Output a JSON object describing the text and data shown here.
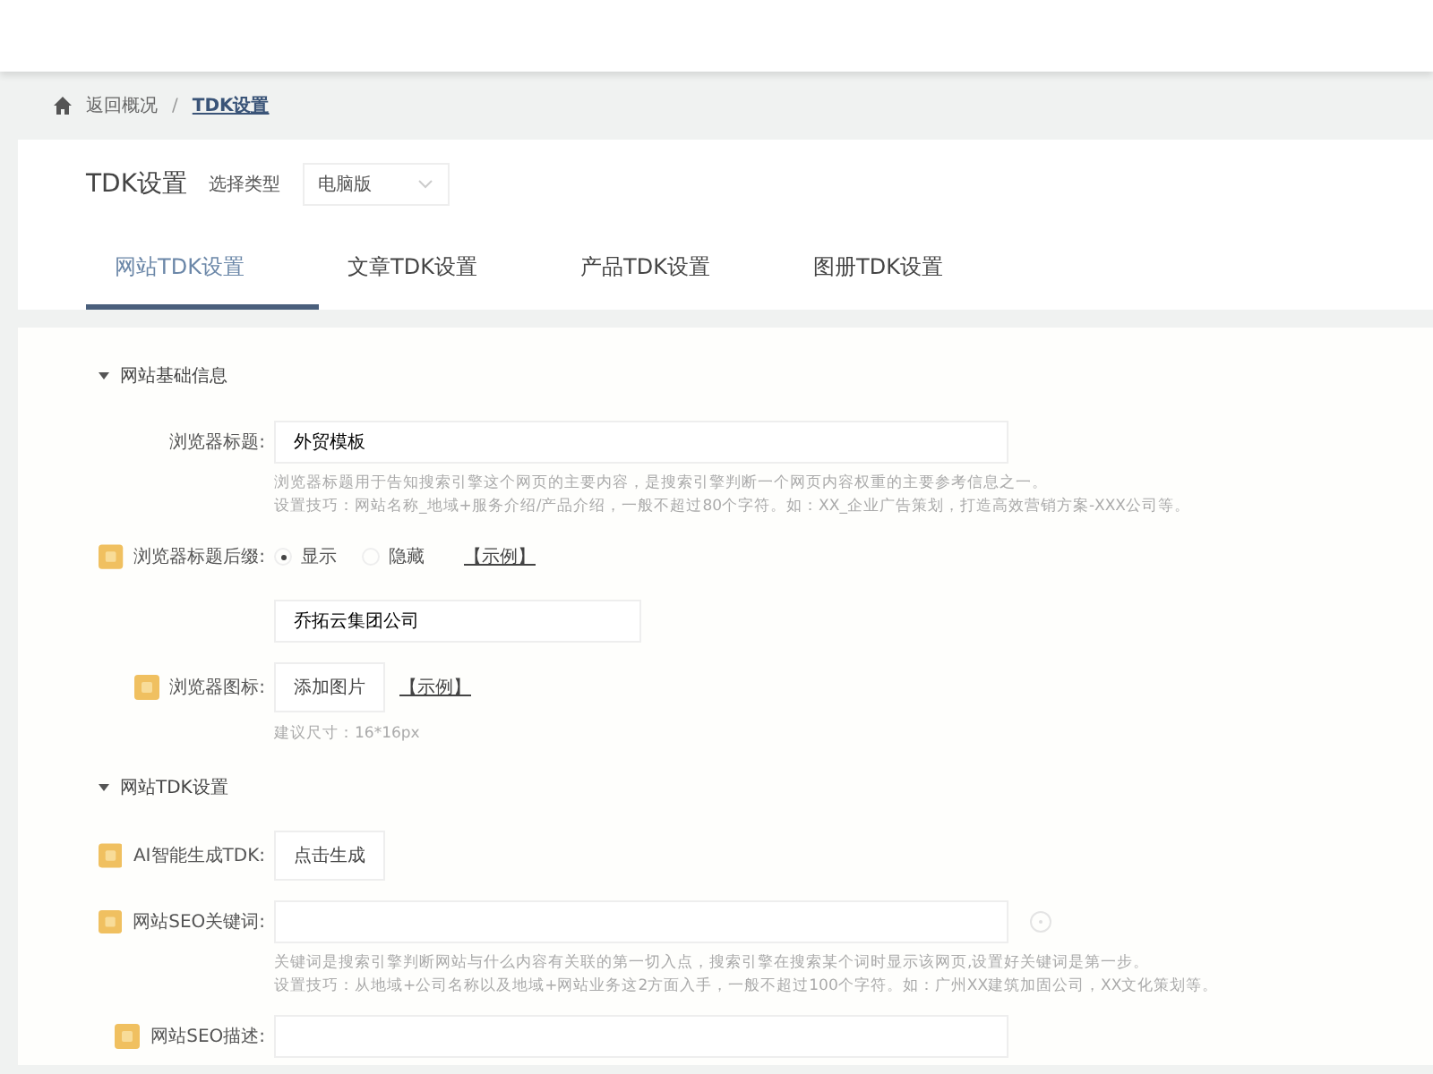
{
  "breadcrumb": [
    {
      "label": "返回概况"
    },
    {
      "label": "TDK设置"
    }
  ],
  "breadcrumb_separator": "/",
  "header": {
    "title": "TDK设置",
    "type_label": "选择类型",
    "type_value": "电脑版"
  },
  "tabs": [
    {
      "label": "网站TDK设置",
      "selected": true
    },
    {
      "label": "文章TDK设置",
      "selected": false
    },
    {
      "label": "产品TDK设置",
      "selected": false
    },
    {
      "label": "图册TDK设置",
      "selected": false
    }
  ],
  "sections": [
    {
      "title": "网站基础信息",
      "expanded": true,
      "fields": [
        {
          "kind": "text",
          "badge": false,
          "label": "浏览器标题:",
          "value": "外贸模板",
          "wide": true,
          "help": [
            "浏览器标题用于告知搜索引擎这个网页的主要内容，是搜索引擎判断一个网页内容权重的主要参考信息之一。",
            "设置技巧：网站名称_地域+服务介绍/产品介绍，一般不超过80个字符。如：XX_企业广告策划，打造高效营销方案-XXX公司等。"
          ]
        },
        {
          "kind": "radio",
          "badge": true,
          "label": "浏览器标题后缀:",
          "options": [
            {
              "label": "显示",
              "selected": true
            },
            {
              "label": "隐藏",
              "selected": false
            }
          ],
          "example": "【示例】"
        },
        {
          "kind": "text",
          "badge": false,
          "value": "乔拓云集团公司",
          "wide": false
        },
        {
          "kind": "upload",
          "badge": true,
          "label": "浏览器图标:",
          "button": "添加图片",
          "example": "【示例】",
          "hint": "建议尺寸：16*16px"
        }
      ]
    },
    {
      "title": "网站TDK设置",
      "expanded": true,
      "fields": [
        {
          "kind": "button",
          "badge": true,
          "label": "AI智能生成TDK:",
          "button": "点击生成"
        },
        {
          "kind": "text",
          "badge": true,
          "label": "网站SEO关键词:",
          "wide": true,
          "help_icon": true,
          "help": [
            "关键词是搜索引擎判断网站与什么内容有关联的第一切入点，搜索引擎在搜索某个词时显示该网页,设置好关键词是第一步。",
            "设置技巧：从地域+公司名称以及地域+网站业务这2方面入手，一般不超过100个字符。如：广州XX建筑加固公司，XX文化策划等。"
          ]
        },
        {
          "kind": "text",
          "badge": true,
          "label": "网站SEO描述:",
          "wide": true
        }
      ]
    }
  ]
}
